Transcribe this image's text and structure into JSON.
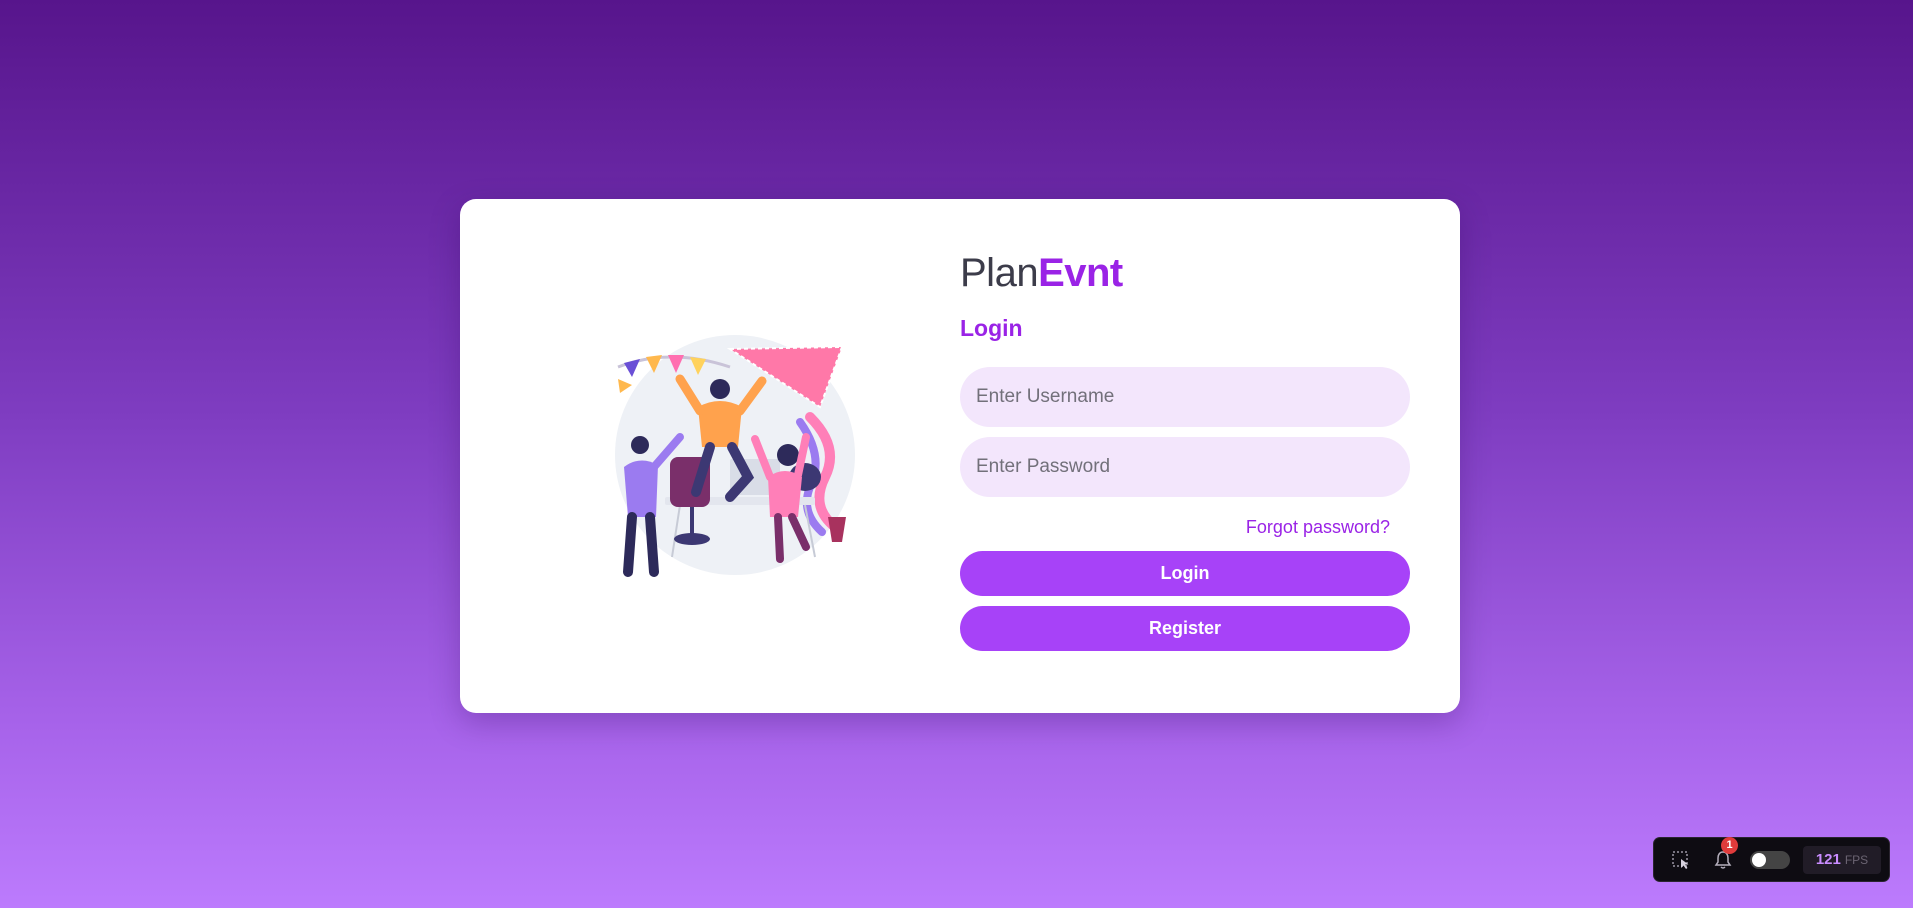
{
  "brand": {
    "name_part1": "Plan",
    "name_part2": "Evnt"
  },
  "form": {
    "heading": "Login",
    "username_placeholder": "Enter Username",
    "password_placeholder": "Enter Password",
    "username_value": "",
    "password_value": "",
    "forgot_label": "Forgot password?",
    "login_label": "Login",
    "register_label": "Register"
  },
  "illustration": {
    "icon": "party-celebration-illustration"
  },
  "devbar": {
    "select_tool_icon": "cursor-select-icon",
    "notifications_icon": "bell-icon",
    "notification_count": "1",
    "theme_toggle_on": false,
    "fps_value": "121",
    "fps_unit": "FPS"
  },
  "colors": {
    "accent": "#9a23e6",
    "button": "#a742f8",
    "field_bg": "#f3e6fc",
    "bg_top": "#57158c",
    "bg_bottom": "#bc7bfd"
  }
}
